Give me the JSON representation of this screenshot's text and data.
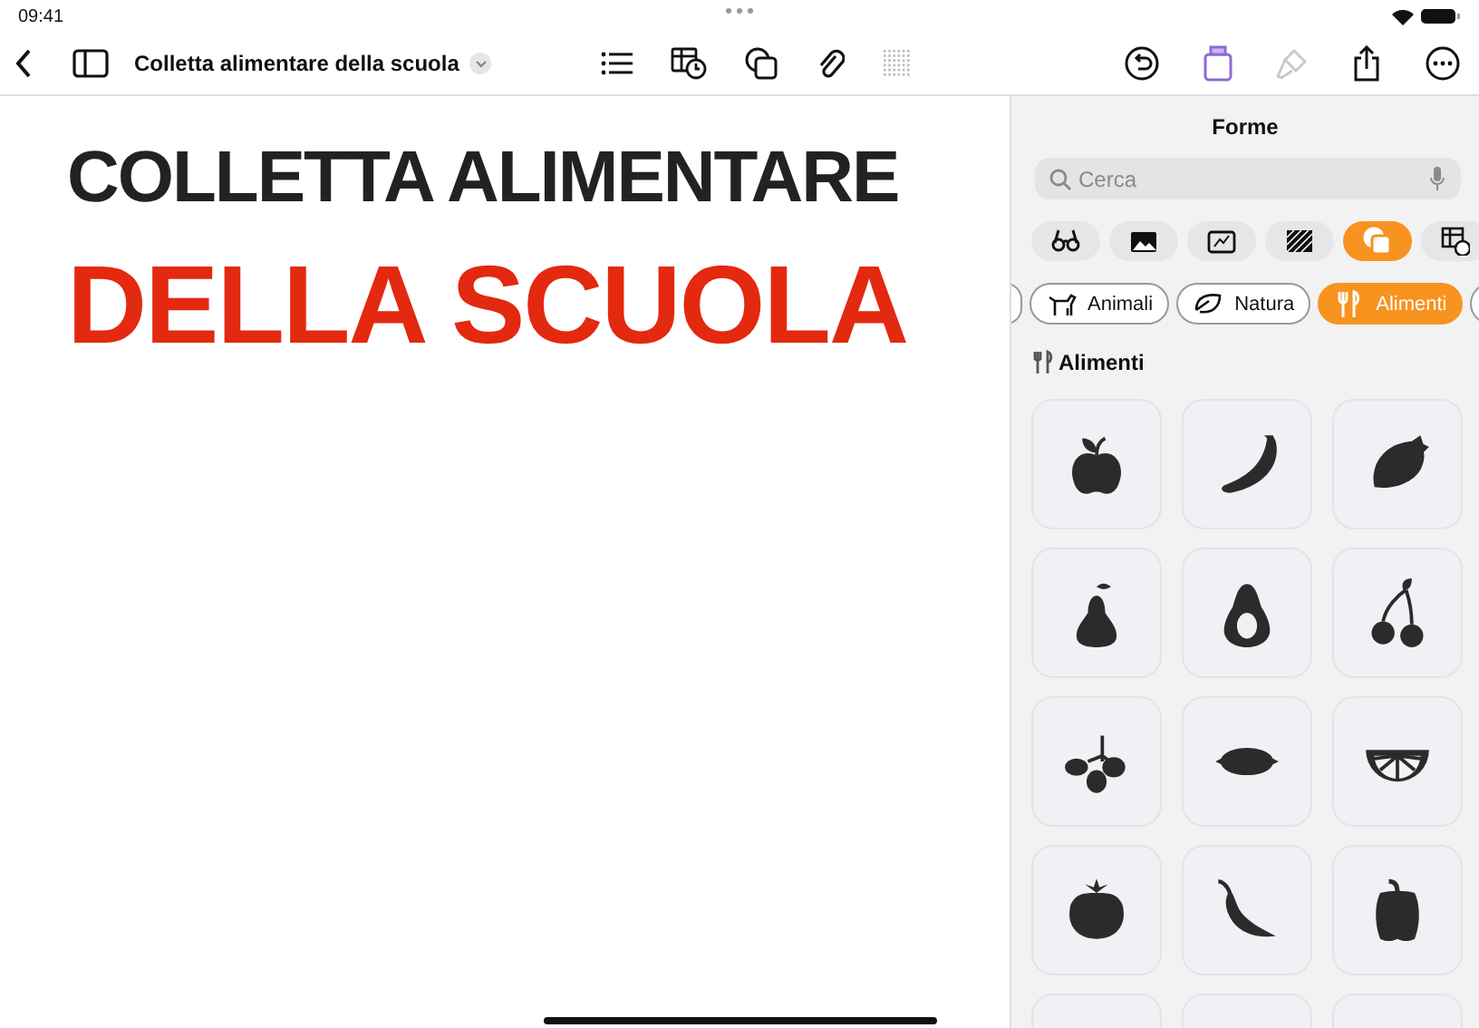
{
  "status_bar": {
    "time": "09:41"
  },
  "toolbar": {
    "document_title": "Colletta alimentare della scuola",
    "format_selected": true,
    "brush_disabled": true
  },
  "document": {
    "lines": [
      {
        "text": "COLLETTA ALIMENTARE",
        "color": "#222222"
      },
      {
        "text": "DELLA SCUOLA",
        "color": "#e3290f"
      }
    ]
  },
  "panel": {
    "title": "Forme",
    "search": {
      "placeholder": "Cerca"
    },
    "sources": [
      {
        "kind": "binoculars",
        "selected": false
      },
      {
        "kind": "photo",
        "selected": false
      },
      {
        "kind": "media",
        "selected": false
      },
      {
        "kind": "texture",
        "selected": false
      },
      {
        "kind": "shapes",
        "selected": true
      },
      {
        "kind": "table",
        "selected": false
      }
    ],
    "categories": [
      {
        "kind": "cut",
        "selected": false
      },
      {
        "kind": "animal",
        "label": "Animali",
        "selected": false
      },
      {
        "kind": "leaf",
        "label": "Natura",
        "selected": false
      },
      {
        "kind": "food",
        "label": "Alimenti",
        "selected": true
      },
      {
        "kind": "arch",
        "selected": false
      }
    ],
    "section_title": "Alimenti",
    "shapes": [
      {
        "kind": "apple"
      },
      {
        "kind": "banana"
      },
      {
        "kind": "strawberry"
      },
      {
        "kind": "pear"
      },
      {
        "kind": "avocado"
      },
      {
        "kind": "cherries"
      },
      {
        "kind": "olives"
      },
      {
        "kind": "lemon"
      },
      {
        "kind": "citrus-slice"
      },
      {
        "kind": "tomato"
      },
      {
        "kind": "chili"
      },
      {
        "kind": "bell-pepper"
      },
      {
        "kind": "hidden"
      },
      {
        "kind": "hidden"
      },
      {
        "kind": "hidden"
      }
    ]
  }
}
